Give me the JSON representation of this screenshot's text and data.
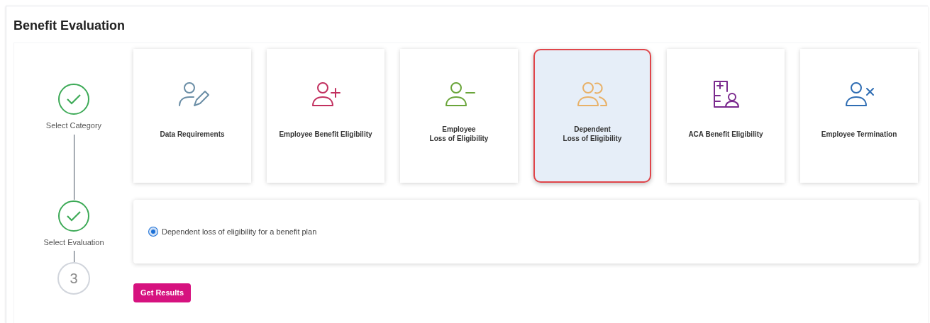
{
  "title": "Benefit Evaluation",
  "steps": [
    {
      "kind": "done",
      "label": "Select Category"
    },
    {
      "kind": "done",
      "label": "Select Evaluation"
    },
    {
      "kind": "pending",
      "number": "3"
    }
  ],
  "categories": [
    {
      "kind": "edit",
      "color": "#6b8ea6",
      "lines": [
        "Data Requirements"
      ],
      "selected": false
    },
    {
      "kind": "add",
      "color": "#c2305f",
      "lines": [
        "Employee Benefit Eligibility"
      ],
      "selected": false
    },
    {
      "kind": "remove",
      "color": "#6aa53a",
      "lines": [
        "Employee",
        "Loss of Eligibility"
      ],
      "selected": false
    },
    {
      "kind": "group",
      "color": "#e8b168",
      "lines": [
        "Dependent",
        "Loss of Eligibility"
      ],
      "selected": true
    },
    {
      "kind": "document",
      "color": "#7b2a8e",
      "lines": [
        "ACA Benefit Eligibility"
      ],
      "selected": false
    },
    {
      "kind": "cross",
      "color": "#2f6db3",
      "lines": [
        "Employee Termination"
      ],
      "selected": false
    }
  ],
  "evaluations": [
    {
      "label": "Dependent loss of eligibility for a benefit plan",
      "selected": true
    }
  ],
  "button": "Get Results"
}
